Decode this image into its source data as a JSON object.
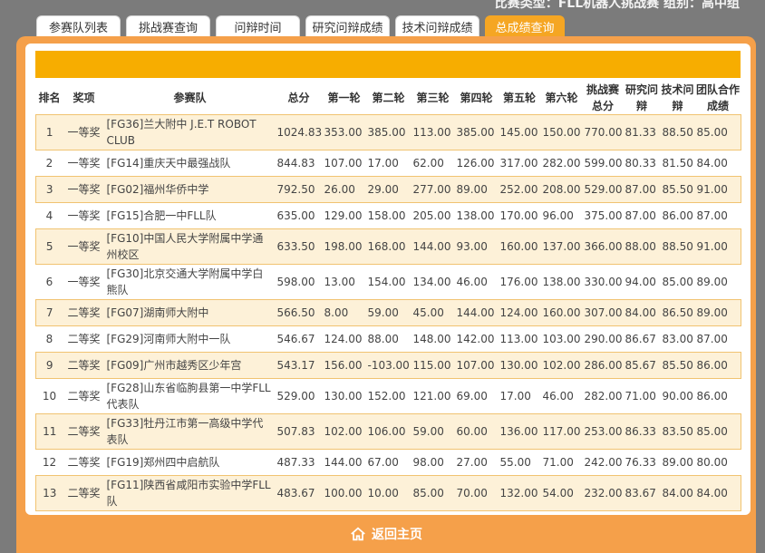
{
  "header": {
    "info": "比赛类型：FLL机器人挑战赛 组别：高中组"
  },
  "tabs": [
    {
      "label": "参赛队列表",
      "active": false
    },
    {
      "label": "挑战赛查询",
      "active": false
    },
    {
      "label": "问辩时间",
      "active": false
    },
    {
      "label": "研究问辩成绩",
      "active": false
    },
    {
      "label": "技术问辩成绩",
      "active": false
    },
    {
      "label": "总成绩查询",
      "active": true
    }
  ],
  "table": {
    "columns": [
      "排名",
      "奖项",
      "参赛队",
      "总分",
      "第一轮",
      "第二轮",
      "第三轮",
      "第四轮",
      "第五轮",
      "第六轮",
      "挑战赛总分",
      "研究问辩",
      "技术问辩",
      "团队合作成绩"
    ],
    "rows": [
      [
        "1",
        "一等奖",
        "[FG36]兰大附中 J.E.T ROBOT CLUB",
        "1024.83",
        "353.00",
        "385.00",
        "113.00",
        "385.00",
        "145.00",
        "150.00",
        "770.00",
        "81.33",
        "88.50",
        "85.00"
      ],
      [
        "2",
        "一等奖",
        "[FG14]重庆天中最强战队",
        "844.83",
        "107.00",
        "17.00",
        "62.00",
        "126.00",
        "317.00",
        "282.00",
        "599.00",
        "80.33",
        "81.50",
        "84.00"
      ],
      [
        "3",
        "一等奖",
        "[FG02]福州华侨中学",
        "792.50",
        "26.00",
        "29.00",
        "277.00",
        "89.00",
        "252.00",
        "208.00",
        "529.00",
        "87.00",
        "85.50",
        "91.00"
      ],
      [
        "4",
        "一等奖",
        "[FG15]合肥一中FLL队",
        "635.00",
        "129.00",
        "158.00",
        "205.00",
        "138.00",
        "170.00",
        "96.00",
        "375.00",
        "87.00",
        "86.00",
        "87.00"
      ],
      [
        "5",
        "一等奖",
        "[FG10]中国人民大学附属中学通州校区",
        "633.50",
        "198.00",
        "168.00",
        "144.00",
        "93.00",
        "160.00",
        "137.00",
        "366.00",
        "88.00",
        "88.50",
        "91.00"
      ],
      [
        "6",
        "一等奖",
        "[FG30]北京交通大学附属中学白熊队",
        "598.00",
        "13.00",
        "154.00",
        "134.00",
        "46.00",
        "176.00",
        "138.00",
        "330.00",
        "94.00",
        "85.00",
        "89.00"
      ],
      [
        "7",
        "二等奖",
        "[FG07]湖南师大附中",
        "566.50",
        "8.00",
        "59.00",
        "45.00",
        "144.00",
        "124.00",
        "160.00",
        "307.00",
        "84.00",
        "86.50",
        "89.00"
      ],
      [
        "8",
        "二等奖",
        "[FG29]河南师大附中一队",
        "546.67",
        "124.00",
        "88.00",
        "148.00",
        "142.00",
        "113.00",
        "103.00",
        "290.00",
        "86.67",
        "83.00",
        "87.00"
      ],
      [
        "9",
        "二等奖",
        "[FG09]广州市越秀区少年宫",
        "543.17",
        "156.00",
        "-103.00",
        "115.00",
        "107.00",
        "130.00",
        "102.00",
        "286.00",
        "85.67",
        "85.50",
        "86.00"
      ],
      [
        "10",
        "二等奖",
        "[FG28]山东省临朐县第一中学FLL代表队",
        "529.00",
        "130.00",
        "152.00",
        "121.00",
        "69.00",
        "17.00",
        "46.00",
        "282.00",
        "71.00",
        "90.00",
        "86.00"
      ],
      [
        "11",
        "二等奖",
        "[FG33]牡丹江市第一高级中学代表队",
        "507.83",
        "102.00",
        "106.00",
        "59.00",
        "60.00",
        "136.00",
        "117.00",
        "253.00",
        "86.33",
        "83.50",
        "85.00"
      ],
      [
        "12",
        "二等奖",
        "[FG19]郑州四中启航队",
        "487.33",
        "144.00",
        "67.00",
        "98.00",
        "27.00",
        "55.00",
        "71.00",
        "242.00",
        "76.33",
        "89.00",
        "80.00"
      ],
      [
        "13",
        "二等奖",
        "[FG11]陕西省咸阳市实验中学FLL队",
        "483.67",
        "100.00",
        "10.00",
        "85.00",
        "70.00",
        "132.00",
        "54.00",
        "232.00",
        "83.67",
        "84.00",
        "84.00"
      ]
    ]
  },
  "footer": {
    "back_label": "返回主页"
  },
  "colors": {
    "accent": "#f5a623",
    "panel": "#f5a04a",
    "bar": "#f7ad00",
    "row_highlight": "#fdf1d8"
  }
}
